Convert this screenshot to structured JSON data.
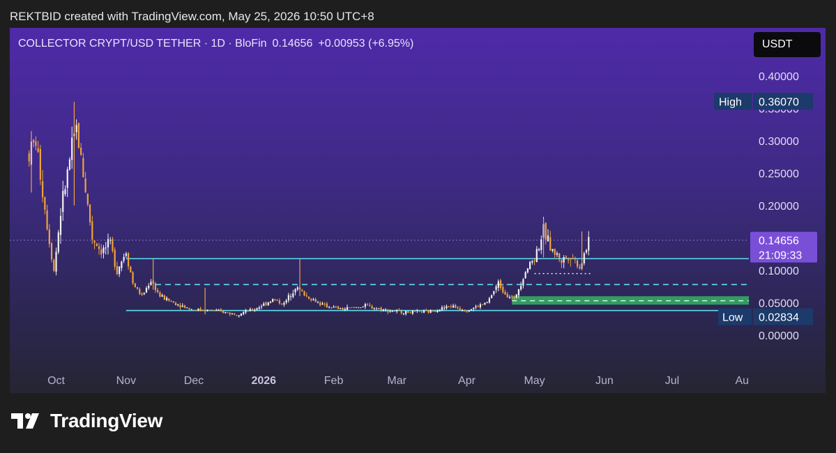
{
  "credit": "REKTBID created with TradingView.com, May 25, 2026 10:50 UTC+8",
  "header": {
    "pair": "COLLECTOR CRYPT/USD TETHER · 1D · BloFin",
    "price": "0.14656",
    "change": "+0.00953 (+6.95%)"
  },
  "unit_button": "USDT",
  "footer": {
    "logo_text": "TradingView",
    "logo_icon": "tradingview-logo-icon"
  },
  "colors": {
    "up": "#f2f2f2",
    "down": "#f0a33c",
    "level": "#5fe0f0",
    "zone": "#35b063",
    "price_tag": "#7a4fd8"
  },
  "chart_data": {
    "type": "candlestick",
    "title": "",
    "xlabel": "",
    "ylabel": "",
    "x_ticks": [
      "Oct",
      "Nov",
      "Dec",
      "2026",
      "Feb",
      "Mar",
      "Apr",
      "May",
      "Jun",
      "Jul",
      "Au"
    ],
    "y_ticks": [
      "0.40000",
      "0.35000",
      "0.30000",
      "0.25000",
      "0.20000",
      "0.10000",
      "0.05000",
      "0.00000"
    ],
    "ylim": [
      -0.012,
      0.415
    ],
    "x_range": [
      "2025-09-16",
      "2026-08-04"
    ],
    "grid": false,
    "current_price": {
      "value": 0.14656,
      "label": "0.14656",
      "countdown": "21:09:33"
    },
    "high": {
      "label": "High",
      "value": 0.3607,
      "text": "0.36070"
    },
    "low": {
      "label": "Low",
      "value": 0.02834,
      "text": "0.02834"
    },
    "levels": [
      {
        "style": "solid",
        "value": 0.118,
        "from": "2025-11-01"
      },
      {
        "style": "dashed",
        "value": 0.078,
        "from": "2025-11-14"
      },
      {
        "style": "solid",
        "value": 0.038,
        "from": "2025-11-01"
      }
    ],
    "zone": {
      "low": 0.047,
      "high": 0.06,
      "from": "2026-04-21"
    },
    "zone_dashed_level": 0.053,
    "dotted_level": {
      "value": 0.095,
      "from": "2026-05-01",
      "to": "2026-05-26"
    },
    "path": [
      {
        "date": "2025-09-19",
        "close": 0.28
      },
      {
        "date": "2025-09-22",
        "close": 0.3
      },
      {
        "date": "2025-09-27",
        "close": 0.17
      },
      {
        "date": "2025-09-30",
        "close": 0.1
      },
      {
        "date": "2025-10-03",
        "close": 0.19
      },
      {
        "date": "2025-10-07",
        "close": 0.27
      },
      {
        "date": "2025-10-10",
        "close": 0.32
      },
      {
        "date": "2025-10-13",
        "close": 0.25
      },
      {
        "date": "2025-10-17",
        "close": 0.15
      },
      {
        "date": "2025-10-21",
        "close": 0.13
      },
      {
        "date": "2025-10-25",
        "close": 0.14
      },
      {
        "date": "2025-10-28",
        "close": 0.1
      },
      {
        "date": "2025-11-01",
        "close": 0.13
      },
      {
        "date": "2025-11-04",
        "close": 0.08
      },
      {
        "date": "2025-11-08",
        "close": 0.06
      },
      {
        "date": "2025-11-12",
        "close": 0.085
      },
      {
        "date": "2025-11-16",
        "close": 0.06
      },
      {
        "date": "2025-11-22",
        "close": 0.05
      },
      {
        "date": "2025-11-30",
        "close": 0.04
      },
      {
        "date": "2025-12-10",
        "close": 0.038
      },
      {
        "date": "2025-12-20",
        "close": 0.032
      },
      {
        "date": "2025-12-28",
        "close": 0.04
      },
      {
        "date": "2026-01-05",
        "close": 0.055
      },
      {
        "date": "2026-01-10",
        "close": 0.048
      },
      {
        "date": "2026-01-15",
        "close": 0.075
      },
      {
        "date": "2026-01-20",
        "close": 0.06
      },
      {
        "date": "2026-01-28",
        "close": 0.045
      },
      {
        "date": "2026-02-05",
        "close": 0.04
      },
      {
        "date": "2026-02-15",
        "close": 0.045
      },
      {
        "date": "2026-02-25",
        "close": 0.038
      },
      {
        "date": "2026-03-05",
        "close": 0.035
      },
      {
        "date": "2026-03-15",
        "close": 0.036
      },
      {
        "date": "2026-03-25",
        "close": 0.045
      },
      {
        "date": "2026-04-01",
        "close": 0.038
      },
      {
        "date": "2026-04-10",
        "close": 0.05
      },
      {
        "date": "2026-04-15",
        "close": 0.08
      },
      {
        "date": "2026-04-18",
        "close": 0.065
      },
      {
        "date": "2026-04-22",
        "close": 0.055
      },
      {
        "date": "2026-04-27",
        "close": 0.1
      },
      {
        "date": "2026-05-01",
        "close": 0.12
      },
      {
        "date": "2026-05-05",
        "close": 0.16
      },
      {
        "date": "2026-05-09",
        "close": 0.13
      },
      {
        "date": "2026-05-13",
        "close": 0.115
      },
      {
        "date": "2026-05-17",
        "close": 0.125
      },
      {
        "date": "2026-05-21",
        "close": 0.105
      },
      {
        "date": "2026-05-24",
        "close": 0.135
      },
      {
        "date": "2026-05-25",
        "close": 0.14656
      }
    ]
  }
}
